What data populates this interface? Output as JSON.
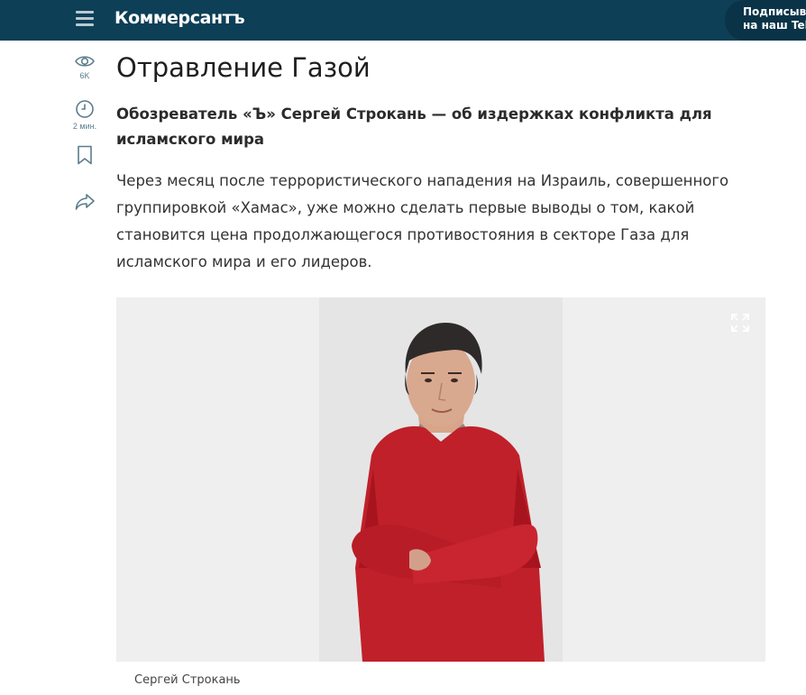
{
  "header": {
    "menu_icon": "hamburger-icon",
    "logo_text": "Коммерсантъ",
    "subscribe_line1": "Подписыва",
    "subscribe_line2": "на наш Tele"
  },
  "rail": {
    "views_icon": "eye-icon",
    "views_count": "6K",
    "time_icon": "clock-icon",
    "read_time": "2 мин.",
    "bookmark_icon": "bookmark-icon",
    "share_icon": "share-icon"
  },
  "article": {
    "title": "Отравление Газой",
    "lead": "Обозреватель «Ъ» Сергей Строкань — об издержках конфликта для исламского мира",
    "body": "Через месяц после террористического нападения на Израиль, совершенного группировкой «Хамас», уже можно сделать первые выводы о том, какой становится цена продолжающегося противостояния в секторе Газа для исламского мира и его лидеров.",
    "photo_caption": "Сергей Строкань",
    "expand_icon": "expand-icon"
  },
  "colors": {
    "header_bg": "#0d3f57",
    "accent_icon": "#5b7d8e",
    "sweater_red": "#c0202a"
  }
}
